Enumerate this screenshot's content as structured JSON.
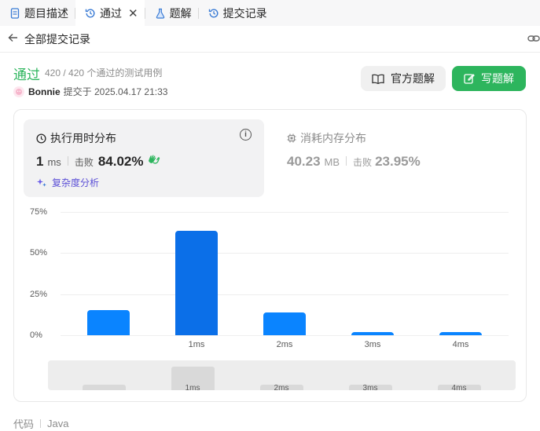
{
  "tabs": [
    {
      "label": "题目描述",
      "icon": "document-icon"
    },
    {
      "label": "通过",
      "icon": "history-icon",
      "close": "✕"
    },
    {
      "label": "题解",
      "icon": "flask-icon"
    },
    {
      "label": "提交记录",
      "icon": "history-icon"
    }
  ],
  "nav": {
    "back_label": "全部提交记录"
  },
  "submission": {
    "status": "通过",
    "cases": "420 / 420 个通过的测试用例",
    "user": "Bonnie",
    "submitted_at": "提交于 2025.04.17 21:33"
  },
  "buttons": {
    "official": "官方题解",
    "write": "写题解"
  },
  "runtime": {
    "title": "执行用时分布",
    "value": "1",
    "unit": "ms",
    "beats_label": "击败",
    "beats": "84.02%",
    "complexity": "复杂度分析"
  },
  "memory": {
    "title": "消耗内存分布",
    "value": "40.23",
    "unit": "MB",
    "beats_label": "击败",
    "beats": "23.95%"
  },
  "chart_data": {
    "type": "bar",
    "categories": [
      "",
      "1ms",
      "2ms",
      "3ms",
      "4ms"
    ],
    "values": [
      15.5,
      63.5,
      14.0,
      2.0,
      2.0
    ],
    "ylim": [
      0,
      75
    ],
    "yticks": [
      "75%",
      "50%",
      "25%",
      "0%"
    ],
    "highlight": "1ms",
    "grid": true,
    "colors": {
      "bar": "#0a84ff",
      "highlight": "#0b6fe8"
    }
  },
  "minimap": {
    "labels": [
      "",
      "1ms",
      "2ms",
      "3ms",
      "4ms"
    ]
  },
  "code": {
    "label": "代码",
    "language": "Java"
  },
  "colors": {
    "accent": "#2db55d",
    "purple": "#5b4fd6"
  }
}
